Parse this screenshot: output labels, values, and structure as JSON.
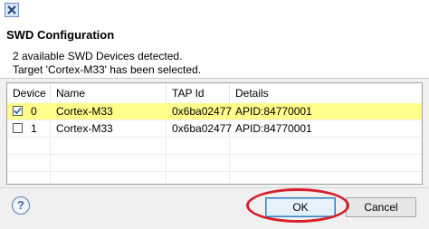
{
  "titlebar": {
    "icon": "app-x-icon"
  },
  "header": {
    "title": "SWD Configuration",
    "message_line1": "2 available SWD Devices detected.",
    "message_line2": "Target 'Cortex-M33' has been selected."
  },
  "table": {
    "columns": [
      "Device",
      "Name",
      "TAP Id",
      "Details"
    ],
    "rows": [
      {
        "checked": true,
        "device": "0",
        "name": "Cortex-M33",
        "tap_id": "0x6ba02477",
        "details": "APID:84770001"
      },
      {
        "checked": false,
        "device": "1",
        "name": "Cortex-M33",
        "tap_id": "0x6ba02477",
        "details": "APID:84770001"
      }
    ],
    "highlight_color": "#fcfc6e"
  },
  "footer": {
    "help_icon": "help-icon",
    "help_glyph": "?",
    "ok_label": "OK",
    "cancel_label": "Cancel",
    "annotation_color": "#d61f28"
  }
}
